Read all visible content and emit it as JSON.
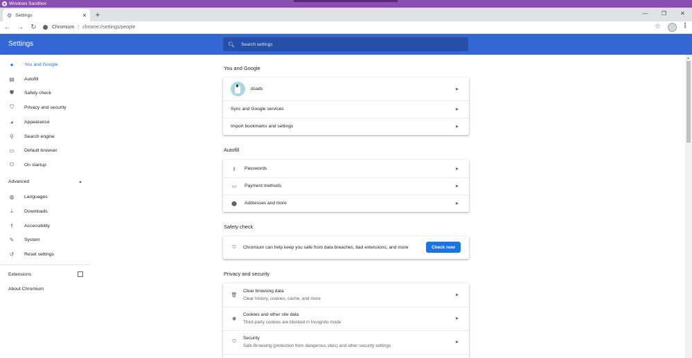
{
  "sandbox": {
    "title": "Windows Sandbox"
  },
  "tab": {
    "title": "Settings",
    "close": "✕"
  },
  "new_tab": "+",
  "window": {
    "minimize": "—",
    "restore": "❐",
    "close": "✕"
  },
  "address": {
    "site": "Chromium",
    "separator": "|",
    "url": "chrome://settings/people"
  },
  "header": {
    "title": "Settings",
    "search_placeholder": "Search settings"
  },
  "sidebar": {
    "items": [
      {
        "label": "You and Google",
        "icon": "person-icon"
      },
      {
        "label": "Autofill",
        "icon": "clipboard-icon"
      },
      {
        "label": "Safety check",
        "icon": "shield-check-icon"
      },
      {
        "label": "Privacy and security",
        "icon": "shield-icon"
      },
      {
        "label": "Appearance",
        "icon": "palette-icon"
      },
      {
        "label": "Search engine",
        "icon": "search-icon"
      },
      {
        "label": "Default browser",
        "icon": "browser-icon"
      },
      {
        "label": "On startup",
        "icon": "power-icon"
      }
    ],
    "advanced_label": "Advanced",
    "advanced_items": [
      {
        "label": "Languages",
        "icon": "globe-icon"
      },
      {
        "label": "Downloads",
        "icon": "download-icon"
      },
      {
        "label": "Accessibility",
        "icon": "accessibility-icon"
      },
      {
        "label": "System",
        "icon": "wrench-icon"
      },
      {
        "label": "Reset settings",
        "icon": "history-icon"
      }
    ],
    "extensions_label": "Extensions",
    "about_label": "About Chromium"
  },
  "sections": {
    "you_and_google": {
      "title": "You and Google",
      "profile_name": "dsads",
      "sync": "Sync and Google services",
      "import": "Import bookmarks and settings"
    },
    "autofill": {
      "title": "Autofill",
      "passwords": "Passwords",
      "payment": "Payment methods",
      "addresses": "Addresses and more"
    },
    "safety": {
      "title": "Safety check",
      "text": "Chromium can help keep you safe from data breaches, bad extensions, and more",
      "button": "Check now"
    },
    "privacy": {
      "title": "Privacy and security",
      "rows": [
        {
          "title": "Clear browsing data",
          "sub": "Clear history, cookies, cache, and more"
        },
        {
          "title": "Cookies and other site data",
          "sub": "Third-party cookies are blocked in Incognito mode"
        },
        {
          "title": "Security",
          "sub": "Safe Browsing (protection from dangerous sites) and other security settings"
        }
      ]
    }
  },
  "colors": {
    "accent": "#1a73e8",
    "header": "#3367d6",
    "sandbox": "#8a4db0"
  }
}
